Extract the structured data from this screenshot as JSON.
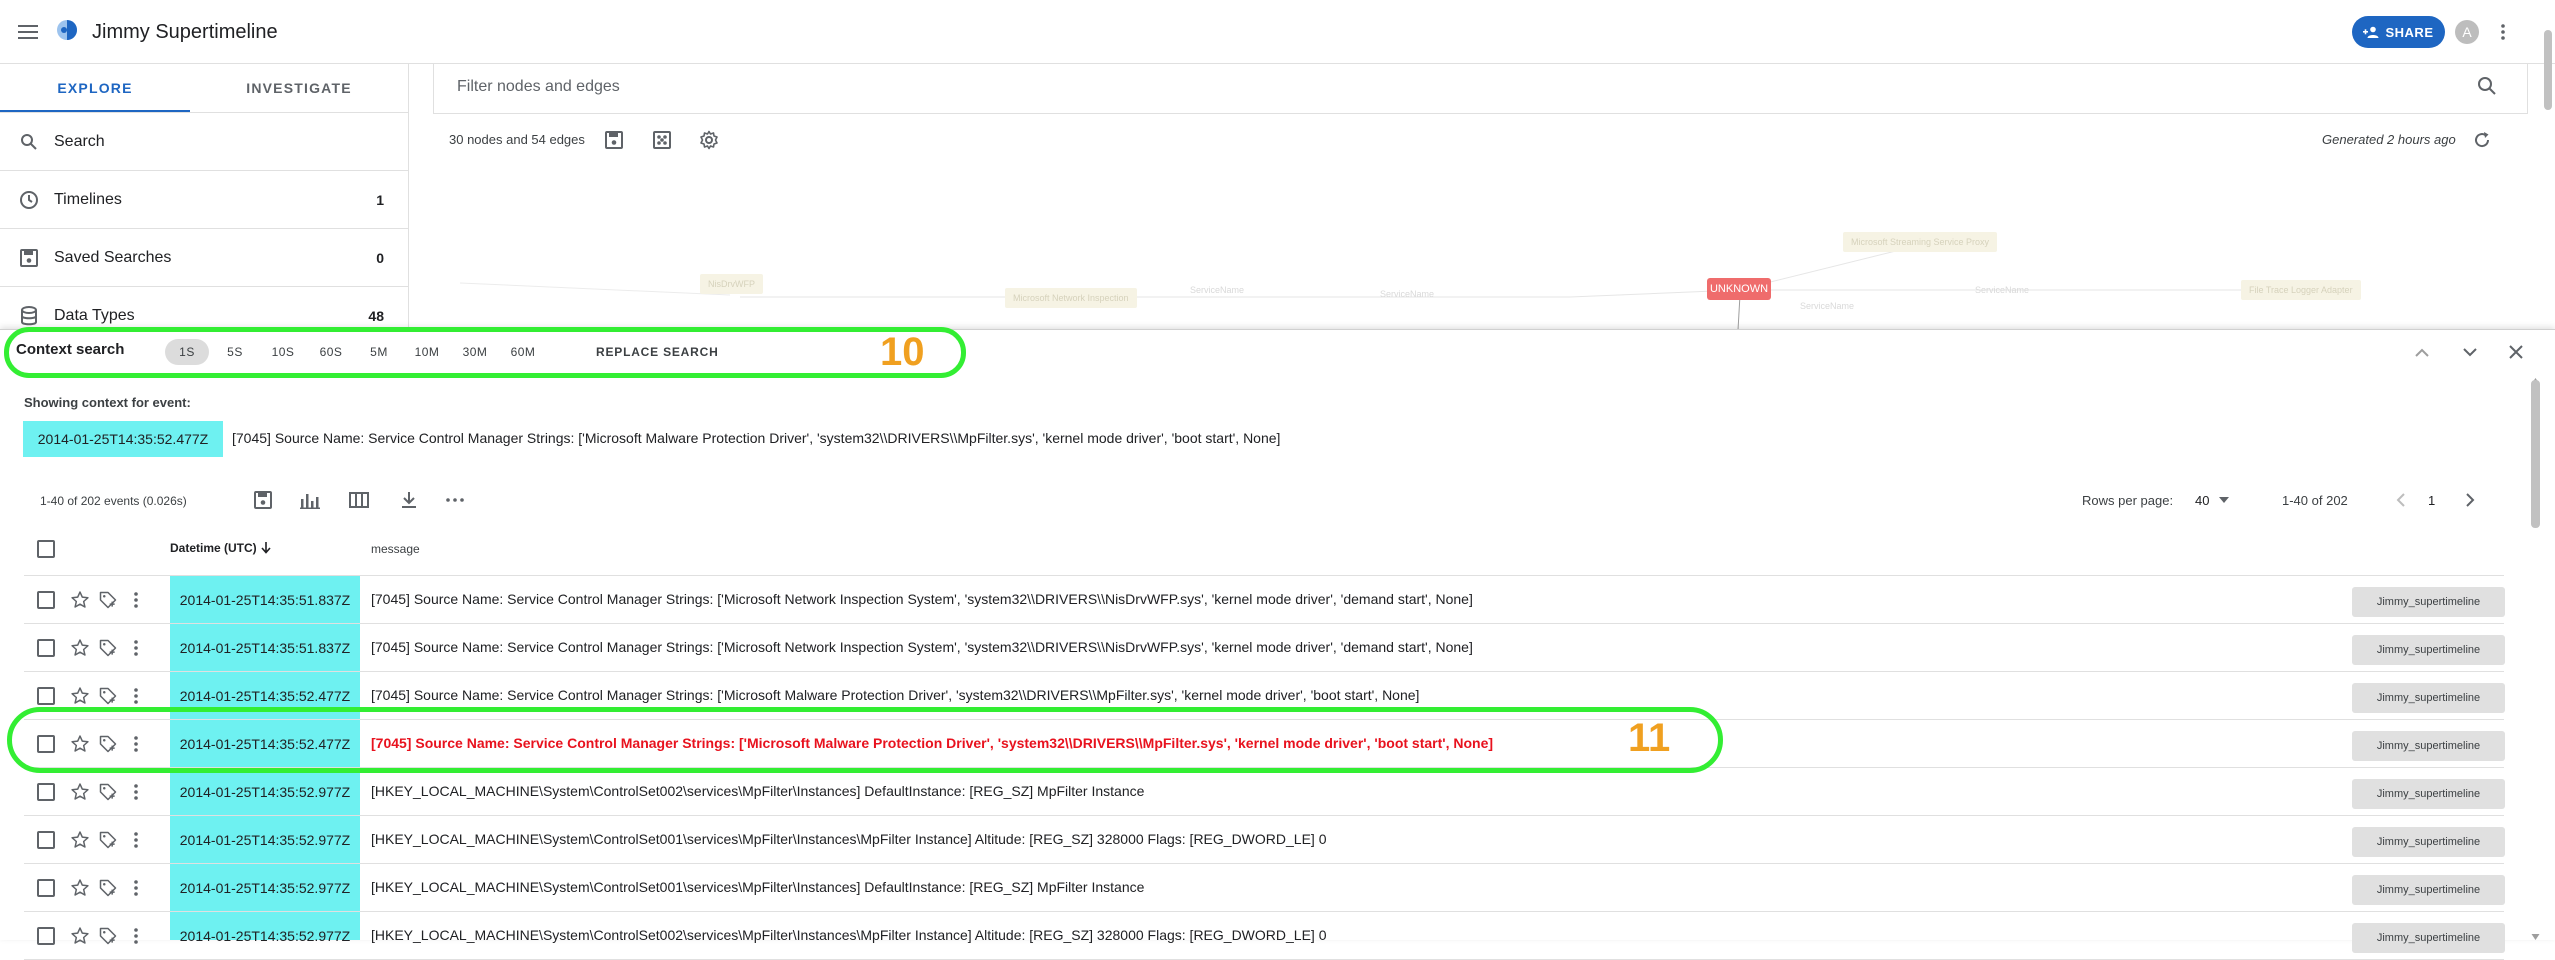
{
  "app": {
    "title": "Jimmy Supertimeline",
    "share_label": "SHARE",
    "avatar_initial": "A"
  },
  "sidebar": {
    "tabs": [
      {
        "label": "EXPLORE"
      },
      {
        "label": "INVESTIGATE"
      }
    ],
    "items": [
      {
        "label": "Search",
        "count": "",
        "icon": "search-icon"
      },
      {
        "label": "Timelines",
        "count": "1",
        "icon": "clock-icon"
      },
      {
        "label": "Saved Searches",
        "count": "0",
        "icon": "save-icon"
      },
      {
        "label": "Data Types",
        "count": "48",
        "icon": "database-icon"
      }
    ]
  },
  "graph": {
    "filter_placeholder": "Filter nodes and edges",
    "stats": "30 nodes and 54 edges",
    "generated": "Generated 2 hours ago",
    "node_unknown_label": "UNKNOWN"
  },
  "context": {
    "title": "Context search",
    "intervals": [
      "1S",
      "5S",
      "10S",
      "60S",
      "5M",
      "10M",
      "30M",
      "60M"
    ],
    "selected_interval": "1S",
    "replace_label": "REPLACE SEARCH",
    "showing_label": "Showing context for event:",
    "event_datetime": "2014-01-25T14:35:52.477Z",
    "event_message": "[7045] Source Name: Service Control Manager Strings: ['Microsoft Malware Protection Driver', 'system32\\\\DRIVERS\\\\MpFilter.sys', 'kernel mode driver', 'boot start', None]"
  },
  "annotations": {
    "a10": "10",
    "a11": "11"
  },
  "table": {
    "events_count": "1-40 of 202 events (0.026s)",
    "rows_per_page_label": "Rows per page:",
    "rows_per_page": "40",
    "range": "1-40 of 202",
    "page": "1",
    "headers": {
      "datetime": "Datetime (UTC)",
      "message": "message"
    },
    "rows": [
      {
        "datetime": "2014-01-25T14:35:51.837Z",
        "message": "[7045] Source Name: Service Control Manager Strings: ['Microsoft Network Inspection System', 'system32\\\\DRIVERS\\\\NisDrvWFP.sys', 'kernel mode driver', 'demand start', None]",
        "timeline": "Jimmy_supertimeline",
        "highlight": false
      },
      {
        "datetime": "2014-01-25T14:35:51.837Z",
        "message": "[7045] Source Name: Service Control Manager Strings: ['Microsoft Network Inspection System', 'system32\\\\DRIVERS\\\\NisDrvWFP.sys', 'kernel mode driver', 'demand start', None]",
        "timeline": "Jimmy_supertimeline",
        "highlight": false
      },
      {
        "datetime": "2014-01-25T14:35:52.477Z",
        "message": "[7045] Source Name: Service Control Manager Strings: ['Microsoft Malware Protection Driver', 'system32\\\\DRIVERS\\\\MpFilter.sys', 'kernel mode driver', 'boot start', None]",
        "timeline": "Jimmy_supertimeline",
        "highlight": false
      },
      {
        "datetime": "2014-01-25T14:35:52.477Z",
        "message": "[7045] Source Name: Service Control Manager Strings: ['Microsoft Malware Protection Driver', 'system32\\\\DRIVERS\\\\MpFilter.sys', 'kernel mode driver', 'boot start', None]",
        "timeline": "Jimmy_supertimeline",
        "highlight": true
      },
      {
        "datetime": "2014-01-25T14:35:52.977Z",
        "message": "[HKEY_LOCAL_MACHINE\\System\\ControlSet002\\services\\MpFilter\\Instances] DefaultInstance: [REG_SZ] MpFilter Instance",
        "timeline": "Jimmy_supertimeline",
        "highlight": false
      },
      {
        "datetime": "2014-01-25T14:35:52.977Z",
        "message": "[HKEY_LOCAL_MACHINE\\System\\ControlSet001\\services\\MpFilter\\Instances\\MpFilter Instance] Altitude: [REG_SZ] 328000 Flags: [REG_DWORD_LE] 0",
        "timeline": "Jimmy_supertimeline",
        "highlight": false
      },
      {
        "datetime": "2014-01-25T14:35:52.977Z",
        "message": "[HKEY_LOCAL_MACHINE\\System\\ControlSet001\\services\\MpFilter\\Instances] DefaultInstance: [REG_SZ] MpFilter Instance",
        "timeline": "Jimmy_supertimeline",
        "highlight": false
      },
      {
        "datetime": "2014-01-25T14:35:52.977Z",
        "message": "[HKEY_LOCAL_MACHINE\\System\\ControlSet002\\services\\MpFilter\\Instances\\MpFilter Instance] Altitude: [REG_SZ] 328000 Flags: [REG_DWORD_LE] 0",
        "timeline": "Jimmy_supertimeline",
        "highlight": false
      }
    ]
  },
  "colors": {
    "accent": "#1e66c2",
    "datetime_bg": "#6ef1f1",
    "highlight_text": "#e8121e",
    "annotation_box": "#33ee33",
    "annotation_label": "#f0a020"
  }
}
